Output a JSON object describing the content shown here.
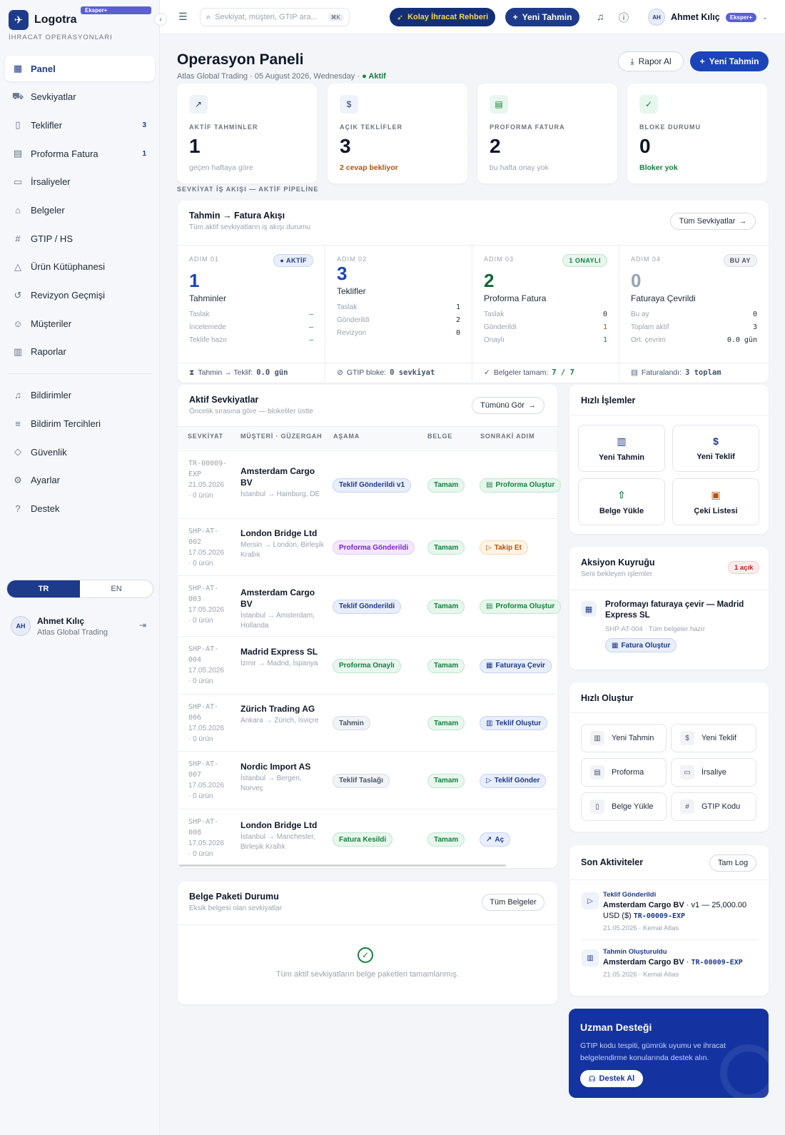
{
  "brand": {
    "name": "Logotra",
    "badge": "Eksper+",
    "subtitle": "İHRACAT OPERASYONLARI"
  },
  "sidebar": {
    "items": [
      {
        "label": "Panel",
        "icon": "grid-icon",
        "count": ""
      },
      {
        "label": "Sevkiyatlar",
        "icon": "truck-icon",
        "count": ""
      },
      {
        "label": "Teklifler",
        "icon": "dollar-file-icon",
        "count": "3"
      },
      {
        "label": "Proforma Fatura",
        "icon": "receipt-icon",
        "count": "1"
      },
      {
        "label": "İrsaliyeler",
        "icon": "archive-icon",
        "count": ""
      },
      {
        "label": "Belgeler",
        "icon": "folder-icon",
        "count": ""
      },
      {
        "label": "GTIP / HS",
        "icon": "hash-icon",
        "count": ""
      },
      {
        "label": "Ürün Kütüphanesi",
        "icon": "shapes-icon",
        "count": ""
      },
      {
        "label": "Revizyon Geçmişi",
        "icon": "history-icon",
        "count": ""
      }
    ],
    "items2": [
      {
        "label": "Müşteriler",
        "icon": "users-icon"
      },
      {
        "label": "Raporlar",
        "icon": "chart-icon"
      }
    ],
    "items3": [
      {
        "label": "Bildirimler",
        "icon": "bell-icon"
      },
      {
        "label": "Bildirim Tercihleri",
        "icon": "sliders-icon"
      },
      {
        "label": "Güvenlik",
        "icon": "shield-icon"
      },
      {
        "label": "Ayarlar",
        "icon": "user-gear-icon"
      },
      {
        "label": "Destek",
        "icon": "help-icon"
      }
    ],
    "lang": {
      "tr": "TR",
      "en": "EN"
    },
    "user": {
      "initials": "AH",
      "name": "Ahmet Kılıç",
      "org": "Atlas Global Trading"
    }
  },
  "topbar": {
    "search_placeholder": "Sevkiyat, müşteri, GTIP ara...",
    "kbd": "⌘K",
    "guide": "Kolay İhracat Rehberi",
    "new_estimate": "Yeni Tahmin",
    "user_initials": "AH",
    "user_name": "Ahmet Kılıç",
    "user_badge": "Eksper+"
  },
  "header": {
    "title": "Operasyon Paneli",
    "company": "Atlas Global Trading",
    "date": "05 August 2026, Wednesday",
    "status": "● Aktif",
    "report": "Rapor Al",
    "new": "Yeni Tahmin"
  },
  "kpis": [
    {
      "label": "AKTİF TAHMİNLER",
      "value": "1",
      "note": "geçen haftaya göre",
      "icon": "trend-icon",
      "color": "#9aa3b2"
    },
    {
      "label": "AÇIK TEKLİFLER",
      "value": "3",
      "note": "2 cevap bekliyor",
      "icon": "dollar-file-icon",
      "color": "#b45309"
    },
    {
      "label": "PROFORMA FATURA",
      "value": "2",
      "note": "bu hafta onay yok",
      "icon": "receipt-icon",
      "color": "#9aa3b2"
    },
    {
      "label": "BLOKE DURUMU",
      "value": "0",
      "note": "Bloker yok",
      "icon": "check-circle-icon",
      "color": "#15803d"
    }
  ],
  "pipeline": {
    "section": "SEVKİYAT İŞ AKIŞI — AKTİF PİPELİNE",
    "title": "Tahmin → Fatura Akışı",
    "subtitle": "Tüm aktif sevkiyatların iş akışı durumu",
    "button": "Tüm Sevkiyatlar",
    "steps": [
      {
        "label": "ADIM 01",
        "tag": "● AKTİF",
        "value": "1",
        "name": "Tahminler",
        "rows": [
          {
            "k": "Taslak",
            "v": "—"
          },
          {
            "k": "İncelemede",
            "v": "—"
          },
          {
            "k": "Teklife hazır",
            "v": "—"
          }
        ],
        "foot_label": "Tahmin → Teklif:",
        "foot_value": "0.0 gün"
      },
      {
        "label": "ADIM 02",
        "tag": "",
        "value": "3",
        "name": "Teklifler",
        "rows": [
          {
            "k": "Taslak",
            "v": "1"
          },
          {
            "k": "Gönderildi",
            "v": "2"
          },
          {
            "k": "Revizyon",
            "v": "0"
          }
        ],
        "foot_label": "GTIP bloke:",
        "foot_value": "0 sevkiyat"
      },
      {
        "label": "ADIM 03",
        "tag": "1 ONAYLI",
        "value": "2",
        "name": "Proforma Fatura",
        "rows": [
          {
            "k": "Taslak",
            "v": "0"
          },
          {
            "k": "Gönderildi",
            "v": "1"
          },
          {
            "k": "Onaylı",
            "v": "1"
          }
        ],
        "foot_label": "Belgeler tamam:",
        "foot_value": "7 / 7"
      },
      {
        "label": "ADIM 04",
        "tag": "BU AY",
        "value": "0",
        "name": "Faturaya Çevrildi",
        "rows": [
          {
            "k": "Bu ay",
            "v": "0"
          },
          {
            "k": "Toplam aktif",
            "v": "3"
          },
          {
            "k": "Ort. çevrim",
            "v": "0.0 gün"
          }
        ],
        "foot_label": "Faturalandı:",
        "foot_value": "3 toplam"
      }
    ]
  },
  "shipments": {
    "title": "Aktif Sevkiyatlar",
    "subtitle": "Öncelik sırasına göre — blokeliler üstte",
    "button": "Tümünü Gör",
    "headers": [
      "SEVKİYAT",
      "MÜŞTERİ · GÜZERGAH",
      "AŞAMA",
      "BELGE",
      "SONRAKİ ADIM"
    ],
    "rows": [
      {
        "code": "TR-00009-EXP",
        "date": "21.05.2026",
        "items": "· 0 ürün",
        "customer": "Amsterdam Cargo BV",
        "route": "İstanbul → Hamburg, DE",
        "stage": "Teklif Gönderildi v1",
        "stage_style": "blue",
        "doc": "Tamam",
        "next": "Proforma Oluştur",
        "next_style": "green",
        "next_icon": "▤"
      },
      {
        "code": "SHP-AT-002",
        "date": "17.05.2026",
        "items": "· 0 ürün",
        "customer": "London Bridge Ltd",
        "route": "Mersin → London, Birleşik Krallık",
        "stage": "Proforma Gönderildi",
        "stage_style": "purple",
        "doc": "Tamam",
        "next": "Takip Et",
        "next_style": "amber",
        "next_icon": "▷"
      },
      {
        "code": "SHP-AT-003",
        "date": "17.05.2026",
        "items": "· 0 ürün",
        "customer": "Amsterdam Cargo BV",
        "route": "İstanbul → Amsterdam, Hollanda",
        "stage": "Teklif Gönderildi",
        "stage_style": "blue",
        "doc": "Tamam",
        "next": "Proforma Oluştur",
        "next_style": "green",
        "next_icon": "▤"
      },
      {
        "code": "SHP-AT-004",
        "date": "17.05.2026",
        "items": "· 0 ürün",
        "customer": "Madrid Express SL",
        "route": "İzmir → Madrid, İspanya",
        "stage": "Proforma Onaylı",
        "stage_style": "green",
        "doc": "Tamam",
        "next": "Faturaya Çevir",
        "next_style": "blue",
        "next_icon": "▦"
      },
      {
        "code": "SHP-AT-006",
        "date": "17.05.2026",
        "items": "· 0 ürün",
        "customer": "Zürich Trading AG",
        "route": "Ankara → Zürich, İsviçre",
        "stage": "Tahmin",
        "stage_style": "gray",
        "doc": "Tamam",
        "next": "Teklif Oluştur",
        "next_style": "blue",
        "next_icon": "▥"
      },
      {
        "code": "SHP-AT-007",
        "date": "17.05.2026",
        "items": "· 0 ürün",
        "customer": "Nordic Import AS",
        "route": "İstanbul → Bergen, Norveç",
        "stage": "Teklif Taslağı",
        "stage_style": "gray",
        "doc": "Tamam",
        "next": "Teklif Gönder",
        "next_style": "blue",
        "next_icon": "▷"
      },
      {
        "code": "SHP-AT-008",
        "date": "17.05.2026",
        "items": "· 0 ürün",
        "customer": "London Bridge Ltd",
        "route": "İstanbul → Manchester, Birleşik Krallık",
        "stage": "Fatura Kesildi",
        "stage_style": "green",
        "doc": "Tamam",
        "next": "Aç",
        "next_style": "blue",
        "next_icon": "↗"
      }
    ]
  },
  "docs": {
    "title": "Belge Paketi Durumu",
    "subtitle": "Eksik belgesi olan sevkiyatlar",
    "button": "Tüm Belgeler",
    "empty": "Tüm aktif sevkiyatların belge paketleri tamamlanmış."
  },
  "quick": {
    "title": "Hızlı İşlemler",
    "items": [
      {
        "label": "Yeni Tahmin",
        "icon": "chart-plus-icon"
      },
      {
        "label": "Yeni Teklif",
        "icon": "dollar-file-icon"
      },
      {
        "label": "Belge Yükle",
        "icon": "file-upload-icon"
      },
      {
        "label": "Çeki Listesi",
        "icon": "box-icon"
      }
    ]
  },
  "queue": {
    "title": "Aksiyon Kuyruğu",
    "subtitle": "Seni bekleyen işlemler",
    "badge": "1 açık",
    "item_title": "Proformayı faturaya çevir — Madrid Express SL",
    "item_meta": "SHP-AT-004 · Tüm belgeler hazır",
    "item_button": "Fatura Oluştur"
  },
  "create": {
    "title": "Hızlı Oluştur",
    "items": [
      {
        "label": "Yeni Tahmin",
        "icon": "chart-icon"
      },
      {
        "label": "Yeni Teklif",
        "icon": "dollar-file-icon"
      },
      {
        "label": "Proforma",
        "icon": "receipt-icon"
      },
      {
        "label": "İrsaliye",
        "icon": "archive-icon"
      },
      {
        "label": "Belge Yükle",
        "icon": "file-icon"
      },
      {
        "label": "GTIP Kodu",
        "icon": "hash-icon"
      }
    ]
  },
  "activity": {
    "title": "Son Aktiviteler",
    "button": "Tam Log",
    "items": [
      {
        "type": "Teklif Gönderildi",
        "company": "Amsterdam Cargo BV",
        "detail": " · v1 — 25,000.00 USD ($) ",
        "code": "TR-00009-EXP",
        "meta": "21.05.2026 · Kemal Atlas"
      },
      {
        "type": "Tahmin Oluşturuldu",
        "company": "Amsterdam Cargo BV",
        "detail": " · ",
        "code": "TR-00009-EXP",
        "meta": "21.05.2026 · Kemal Atlas"
      }
    ]
  },
  "expert": {
    "title": "Uzman Desteği",
    "text": "GTIP kodu tespiti, gümrük uyumu ve ihracat belgelendirme konularında destek alın.",
    "button": "Destek Al"
  }
}
